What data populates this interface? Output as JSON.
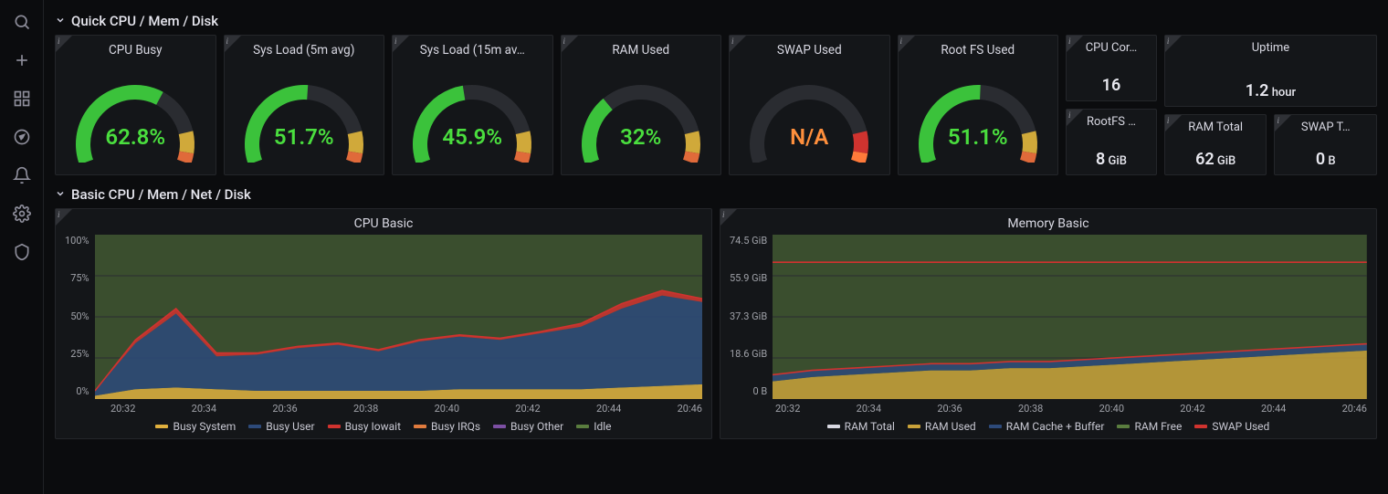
{
  "sidebar": {
    "items": [
      {
        "name": "search-icon"
      },
      {
        "name": "plus-icon"
      },
      {
        "name": "dashboards-icon"
      },
      {
        "name": "explore-icon"
      },
      {
        "name": "alerting-icon"
      },
      {
        "name": "configuration-icon"
      },
      {
        "name": "server-admin-icon"
      }
    ]
  },
  "sections": {
    "quick": "Quick CPU / Mem / Disk",
    "basic": "Basic CPU / Mem / Net / Disk"
  },
  "gauges": [
    {
      "title": "CPU Busy",
      "value": "62.8%",
      "pct": 62.8,
      "na": false
    },
    {
      "title": "Sys Load (5m avg)",
      "value": "51.7%",
      "pct": 51.7,
      "na": false
    },
    {
      "title": "Sys Load (15m av…",
      "value": "45.9%",
      "pct": 45.9,
      "na": false
    },
    {
      "title": "RAM Used",
      "value": "32%",
      "pct": 32.0,
      "na": false
    },
    {
      "title": "SWAP Used",
      "value": "N/A",
      "pct": 0,
      "na": true
    },
    {
      "title": "Root FS Used",
      "value": "51.1%",
      "pct": 51.1,
      "na": false
    }
  ],
  "stats": {
    "top": [
      {
        "title": "CPU Cor…",
        "value": "16",
        "unit": ""
      },
      {
        "title": "Uptime",
        "value": "1.2",
        "unit": " hour"
      }
    ],
    "bottom": [
      {
        "title": "RootFS …",
        "value": "8",
        "unit": " GiB"
      },
      {
        "title": "RAM Total",
        "value": "62",
        "unit": " GiB"
      },
      {
        "title": "SWAP T…",
        "value": "0",
        "unit": " B"
      }
    ]
  },
  "charts": {
    "cpu": {
      "title": "CPU Basic",
      "y_ticks": [
        "100%",
        "75%",
        "50%",
        "25%",
        "0%"
      ],
      "x_ticks": [
        "20:32",
        "20:34",
        "20:36",
        "20:38",
        "20:40",
        "20:42",
        "20:44",
        "20:46"
      ],
      "legend": [
        {
          "label": "Busy System",
          "color": "#e0b03e"
        },
        {
          "label": "Busy User",
          "color": "#2d4a7a"
        },
        {
          "label": "Busy Iowait",
          "color": "#d0332f"
        },
        {
          "label": "Busy IRQs",
          "color": "#e07b3e"
        },
        {
          "label": "Busy Other",
          "color": "#7c4fa3"
        },
        {
          "label": "Idle",
          "color": "#5a7d3f"
        }
      ]
    },
    "mem": {
      "title": "Memory Basic",
      "y_ticks": [
        "74.5 GiB",
        "55.9 GiB",
        "37.3 GiB",
        "18.6 GiB",
        "0 B"
      ],
      "x_ticks": [
        "20:32",
        "20:34",
        "20:36",
        "20:38",
        "20:40",
        "20:42",
        "20:44",
        "20:46"
      ],
      "legend": [
        {
          "label": "RAM Total",
          "color": "#d8d8e2"
        },
        {
          "label": "RAM Used",
          "color": "#c9a23a"
        },
        {
          "label": "RAM Cache + Buffer",
          "color": "#2d4a7a"
        },
        {
          "label": "RAM Free",
          "color": "#5a7d3f"
        },
        {
          "label": "SWAP Used",
          "color": "#d0332f"
        }
      ]
    }
  },
  "chart_data": [
    {
      "type": "area",
      "title": "CPU Basic",
      "xlabel": "",
      "ylabel": "",
      "ylim": [
        0,
        100
      ],
      "x": [
        "20:31",
        "20:32",
        "20:33",
        "20:34",
        "20:35",
        "20:36",
        "20:37",
        "20:38",
        "20:39",
        "20:40",
        "20:41",
        "20:42",
        "20:43",
        "20:44",
        "20:45",
        "20:46"
      ],
      "series": [
        {
          "name": "Busy System",
          "color": "#e0b03e",
          "values": [
            2,
            6,
            7,
            6,
            5,
            5,
            5,
            5,
            5,
            6,
            6,
            6,
            6,
            7,
            8,
            9
          ]
        },
        {
          "name": "Busy User",
          "color": "#2d4a7a",
          "values": [
            3,
            28,
            45,
            20,
            22,
            26,
            28,
            24,
            30,
            32,
            30,
            34,
            38,
            48,
            55,
            50
          ]
        },
        {
          "name": "Busy Iowait",
          "color": "#d0332f",
          "values": [
            0,
            2,
            3,
            2,
            1,
            1,
            1,
            1,
            1,
            1,
            1,
            1,
            2,
            3,
            3,
            2
          ]
        },
        {
          "name": "Busy IRQs",
          "color": "#e07b3e",
          "values": [
            0,
            0,
            0,
            0,
            0,
            0,
            0,
            0,
            0,
            0,
            0,
            0,
            0,
            0,
            0,
            0
          ]
        },
        {
          "name": "Busy Other",
          "color": "#7c4fa3",
          "values": [
            0,
            0,
            0,
            0,
            0,
            0,
            0,
            0,
            0,
            0,
            0,
            0,
            0,
            0,
            0,
            0
          ]
        },
        {
          "name": "Idle",
          "color": "#5a7d3f",
          "values": [
            95,
            64,
            45,
            72,
            72,
            68,
            66,
            70,
            64,
            61,
            63,
            59,
            54,
            42,
            34,
            39
          ]
        }
      ]
    },
    {
      "type": "area",
      "title": "Memory Basic",
      "xlabel": "",
      "ylabel": "",
      "ylim": [
        0,
        74.5
      ],
      "x": [
        "20:31",
        "20:32",
        "20:33",
        "20:34",
        "20:35",
        "20:36",
        "20:37",
        "20:38",
        "20:39",
        "20:40",
        "20:41",
        "20:42",
        "20:43",
        "20:44",
        "20:45",
        "20:46"
      ],
      "series": [
        {
          "name": "RAM Total",
          "color": "#d8d8e2",
          "values": [
            62,
            62,
            62,
            62,
            62,
            62,
            62,
            62,
            62,
            62,
            62,
            62,
            62,
            62,
            62,
            62
          ]
        },
        {
          "name": "RAM Used",
          "color": "#c9a23a",
          "values": [
            8,
            10,
            11,
            12,
            13,
            13,
            14,
            14,
            15,
            16,
            17,
            18,
            19,
            20,
            21,
            22
          ]
        },
        {
          "name": "RAM Cache + Buffer",
          "color": "#2d4a7a",
          "values": [
            3,
            3,
            3,
            3,
            3,
            3,
            3,
            3,
            3,
            3,
            3,
            3,
            3,
            3,
            3,
            3
          ]
        },
        {
          "name": "RAM Free",
          "color": "#5a7d3f",
          "values": [
            51,
            49,
            48,
            47,
            46,
            46,
            45,
            45,
            44,
            43,
            42,
            41,
            40,
            39,
            38,
            37
          ]
        },
        {
          "name": "SWAP Used",
          "color": "#d0332f",
          "values": [
            0,
            0,
            0,
            0,
            0,
            0,
            0,
            0,
            0,
            0,
            0,
            0,
            0,
            0,
            0,
            0
          ]
        }
      ]
    }
  ]
}
